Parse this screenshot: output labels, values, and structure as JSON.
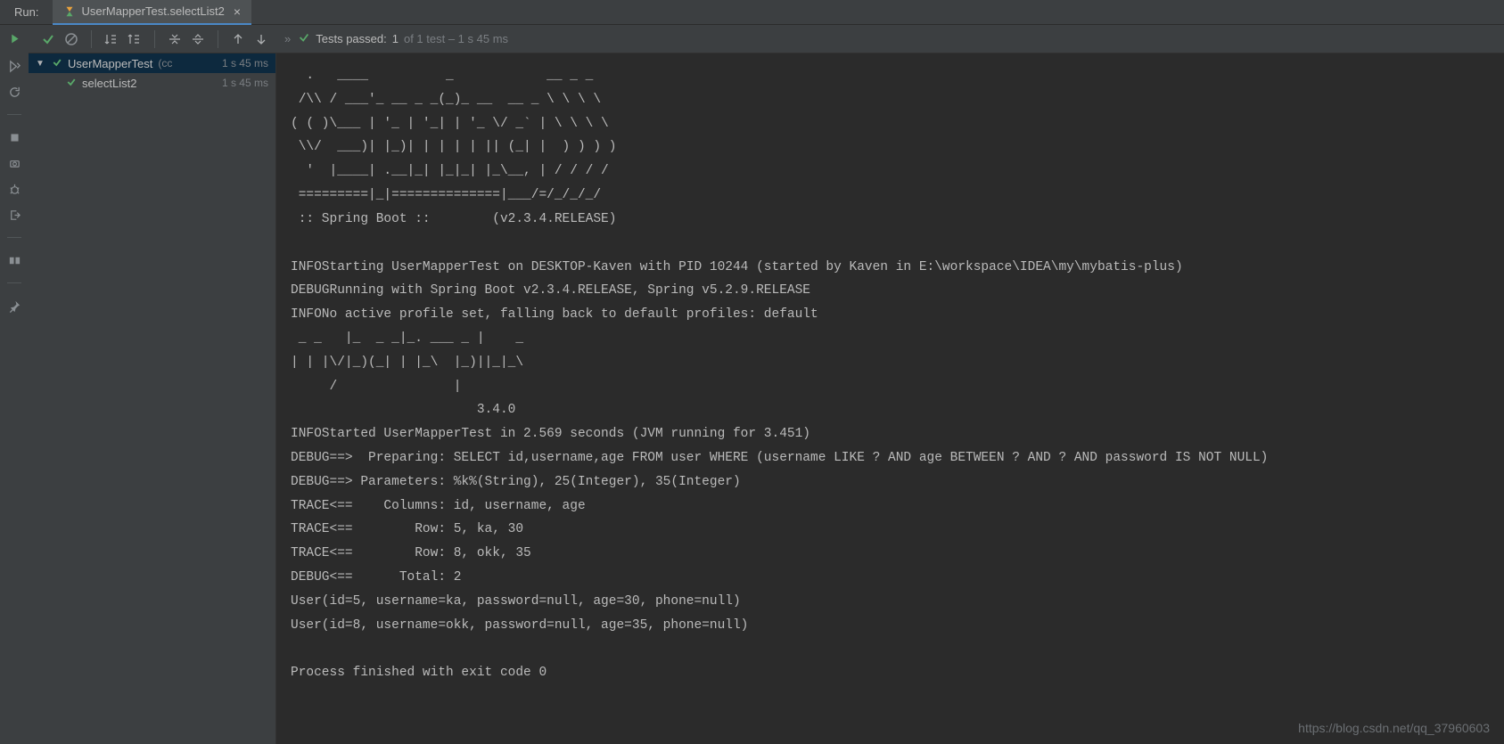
{
  "topBar": {
    "runLabel": "Run:",
    "tab": {
      "title": "UserMapperTest.selectList2"
    }
  },
  "toolbar": {
    "testsPassed": {
      "prefix": "Tests passed:",
      "count": "1",
      "suffix": "of 1 test – 1 s 45 ms"
    }
  },
  "testTree": {
    "root": {
      "name": "UserMapperTest",
      "info": "(cc",
      "time": "1 s 45 ms"
    },
    "child": {
      "name": "selectList2",
      "time": "1 s 45 ms"
    }
  },
  "console": "  .   ____          _            __ _ _\n /\\\\ / ___'_ __ _ _(_)_ __  __ _ \\ \\ \\ \\\n( ( )\\___ | '_ | '_| | '_ \\/ _` | \\ \\ \\ \\\n \\\\/  ___)| |_)| | | | | || (_| |  ) ) ) )\n  '  |____| .__|_| |_|_| |_\\__, | / / / /\n =========|_|==============|___/=/_/_/_/\n :: Spring Boot ::        (v2.3.4.RELEASE)\n\nINFOStarting UserMapperTest on DESKTOP-Kaven with PID 10244 (started by Kaven in E:\\workspace\\IDEA\\my\\mybatis-plus)\nDEBUGRunning with Spring Boot v2.3.4.RELEASE, Spring v5.2.9.RELEASE\nINFONo active profile set, falling back to default profiles: default\n _ _   |_  _ _|_. ___ _ |    _ \n| | |\\/|_)(_| | |_\\  |_)||_|_\\ \n     /               |         \n                        3.4.0 \nINFOStarted UserMapperTest in 2.569 seconds (JVM running for 3.451)\nDEBUG==>  Preparing: SELECT id,username,age FROM user WHERE (username LIKE ? AND age BETWEEN ? AND ? AND password IS NOT NULL)\nDEBUG==> Parameters: %k%(String), 25(Integer), 35(Integer)\nTRACE<==    Columns: id, username, age\nTRACE<==        Row: 5, ka, 30\nTRACE<==        Row: 8, okk, 35\nDEBUG<==      Total: 2\nUser(id=5, username=ka, password=null, age=30, phone=null)\nUser(id=8, username=okk, password=null, age=35, phone=null)\n\nProcess finished with exit code 0",
  "watermark": "https://blog.csdn.net/qq_37960603"
}
